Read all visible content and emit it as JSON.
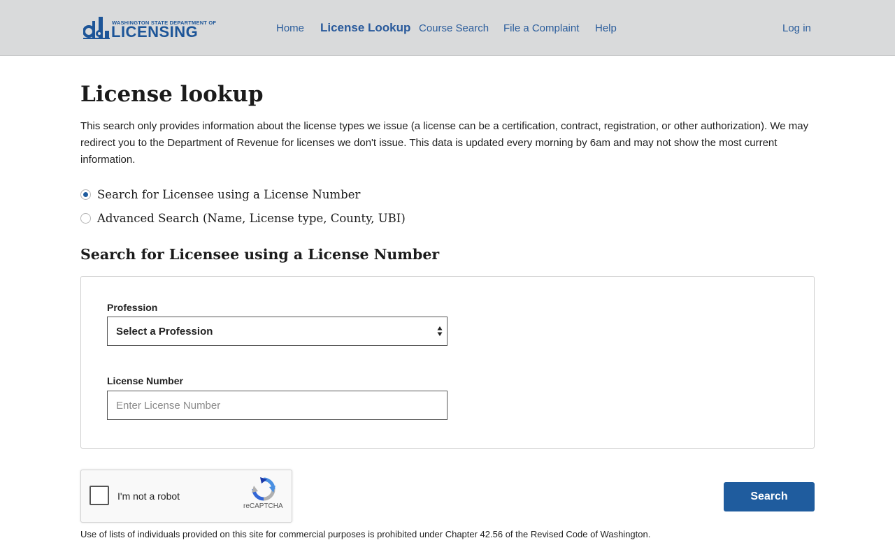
{
  "header": {
    "logo": {
      "small_text": "WASHINGTON STATE DEPARTMENT OF",
      "big_text": "LICENSING",
      "mark_letters": "dol",
      "color": "#1d5598"
    },
    "nav": [
      {
        "label": "Home",
        "active": false
      },
      {
        "label": "License Lookup",
        "active": true
      },
      {
        "label": "Course Search",
        "active": false
      },
      {
        "label": "File a Complaint",
        "active": false
      },
      {
        "label": "Help",
        "active": false
      }
    ],
    "login_label": "Log in"
  },
  "main": {
    "title": "License lookup",
    "intro": "This search only provides information about the license types we issue (a license can be a certification, contract, registration, or other authorization). We may redirect you to the Department of Revenue for licenses we don't issue. This data is updated every morning by 6am and may not show the most current information.",
    "search_options": [
      {
        "label": "Search for Licensee using a License Number",
        "checked": true
      },
      {
        "label": "Advanced Search (Name, License type, County, UBI)",
        "checked": false
      }
    ],
    "section_title": "Search for Licensee using a License Number",
    "form": {
      "profession_label": "Profession",
      "profession_selected": "Select a Profession",
      "license_number_label": "License Number",
      "license_number_placeholder": "Enter License Number",
      "license_number_value": ""
    },
    "captcha": {
      "label": "I'm not a robot",
      "brand": "reCAPTCHA"
    },
    "search_button": "Search",
    "disclaimer": "Use of lists of individuals provided on this site for commercial purposes is prohibited under Chapter 42.56 of the Revised Code of Washington."
  },
  "colors": {
    "header_bg": "#d9dadb",
    "link": "#2b5d9c",
    "primary_button": "#1f5c9e",
    "radio_checked": "#1f5c9e"
  }
}
